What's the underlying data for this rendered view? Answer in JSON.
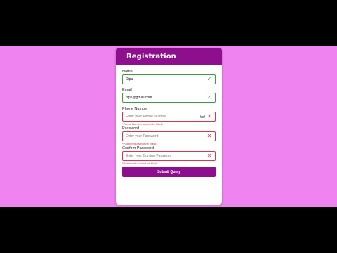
{
  "colors": {
    "background_pink": "#ef83ef",
    "brand_purple": "#8e0f8e",
    "success_green": "#3f9b3f",
    "error_red": "#d9344a"
  },
  "form": {
    "title": "Registration",
    "fields": [
      {
        "label": "Name",
        "value": "Dipu",
        "placeholder": "",
        "status": "valid",
        "status_icon": "check-icon",
        "error": ""
      },
      {
        "label": "Email",
        "value": "dipu@gmail.com",
        "placeholder": "",
        "status": "valid",
        "status_icon": "check-icon",
        "error": ""
      },
      {
        "label": "Phone Number",
        "value": "",
        "placeholder": "Enter your Phone Number",
        "status": "invalid",
        "status_icon": "close-icon",
        "error": "*Phone Number cannot be blank"
      },
      {
        "label": "Password",
        "value": "",
        "placeholder": "Enter your Password",
        "status": "invalid",
        "status_icon": "close-icon",
        "error": "*Password cannot be blank"
      },
      {
        "label": "Confirm Password",
        "value": "",
        "placeholder": "Enter your Confirm Password",
        "status": "invalid",
        "status_icon": "close-icon",
        "error": "*Passwords cannot be blank"
      }
    ],
    "submit_label": "Submit Query"
  },
  "icons": {
    "check": "✓",
    "close": "✕"
  }
}
